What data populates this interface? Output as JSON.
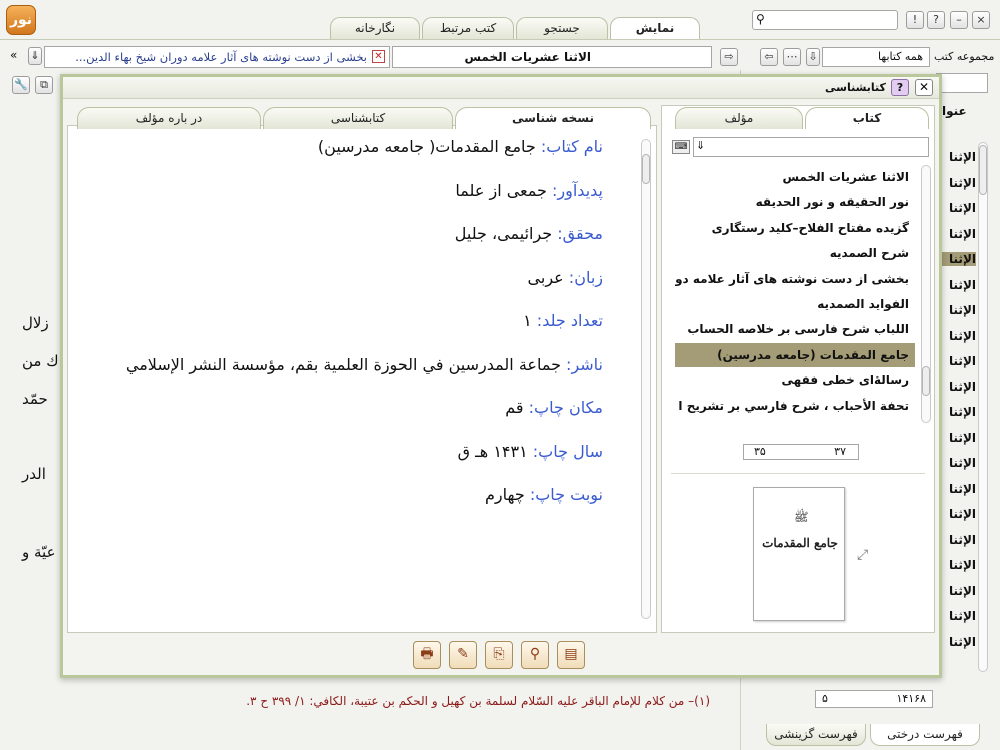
{
  "top_tabs": [
    "نمایش",
    "جستجو",
    "کتب مرتبط",
    "نگارخانه"
  ],
  "window_controls": {
    "help": "?",
    "alert": "!",
    "minimize": "–",
    "close": "×"
  },
  "library": {
    "label": "مجموعه کتب",
    "select_value": "همه کتابها"
  },
  "open_tabs": [
    {
      "title": "الاثنا عشريات الخمس"
    },
    {
      "title": "بخشى از دست نوشته هاى آثار علامه دوران شيخ بهاء الدين..."
    }
  ],
  "right_panel": {
    "header": "عنوا",
    "items_label": "الإثنا",
    "bottom_left": "۱۴۱۶۸",
    "bottom_right": "۵",
    "tab_tree": "فهرست درختی",
    "tab_selected": "فهرست گزینشی"
  },
  "footnote": "(۱)– من كلام للإمام الباقر عليه السّلام لسلمة بن كهيل و الحكم بن عتيبة، الكافي: ١/ ٣٩٩ ح ٣.",
  "bg_fragments": [
    "زلال",
    "ك من",
    "حمّد",
    "الدر",
    "عيّة و"
  ],
  "dialog": {
    "title": "کتابشناسی",
    "left_tabs": [
      "کتاب",
      "مؤلف"
    ],
    "right_tabs": [
      "نسخه شناسی",
      "کتابشناسی",
      "در باره مؤلف"
    ],
    "books": [
      "الاثنا عشريات الخمس",
      "نور الحقيقه و نور الحديقه",
      "گزيده مفتاح الفلاح–كليد رستگارى",
      "شرح الصمديه",
      "بخشى از دست نوشته هاى آثار علامه دورا ...",
      "الفوايد الصمديه",
      "اللباب شرح فارسى بر خلاصه الحساب",
      "جامع المقدمات (جامعه مدرسين)",
      "رسالهٔ‌ای خطی فقهی",
      "تحفة الأحباب ، شرح فارسي بر تشريح ا ..."
    ],
    "selected_index": 7,
    "pager": {
      "current": "۳۷",
      "total": "۳۵"
    },
    "cover_text": "جامع المقدمات",
    "info": [
      {
        "label": "نام کتاب:",
        "value": " جامع المقدمات( جامعه مدرسين)"
      },
      {
        "label": "پدیدآور:",
        "value": " جمعى از علما"
      },
      {
        "label": "محقق:",
        "value": " جرائيمى، جليل"
      },
      {
        "label": "زبان:",
        "value": " عربى"
      },
      {
        "label": "تعداد جلد:",
        "value": " ۱"
      },
      {
        "label": "ناشر:",
        "value": " جماعة المدرسين في الحوزة العلمية بقم، مؤسسة النشر الإسلامي"
      },
      {
        "label": "مکان چاپ:",
        "value": " قم"
      },
      {
        "label": "سال چاپ:",
        "value": " ۱۴۳۱ هـ ق"
      },
      {
        "label": "نوبت چاپ:",
        "value": " چهارم"
      }
    ],
    "toolbar_icons": [
      "print-icon",
      "edit-icon",
      "export-icon",
      "search-icon",
      "page-icon"
    ]
  }
}
